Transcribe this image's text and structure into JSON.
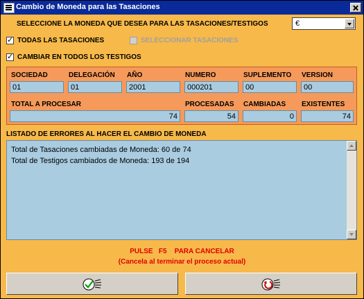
{
  "window": {
    "title": "Cambio de Moneda para las Tasaciones"
  },
  "currency": {
    "prompt": "SELECCIONE LA MONEDA QUE DESEA PARA LAS TASACIONES/TESTIGOS",
    "selected": "€"
  },
  "options": {
    "todas_tasaciones": {
      "label": "TODAS LAS TASACIONES",
      "checked": true
    },
    "seleccionar_tasaciones": {
      "label": "SELECCIONAR TASACIONES",
      "checked": false,
      "enabled": false
    },
    "cambiar_testigos": {
      "label": "CAMBIAR EN TODOS LOS TESTIGOS",
      "checked": true
    }
  },
  "fields": {
    "sociedad": {
      "label": "SOCIEDAD",
      "value": "01"
    },
    "delegacion": {
      "label": "DELEGACIÓN",
      "value": "01"
    },
    "anio": {
      "label": "AÑO",
      "value": "2001"
    },
    "numero": {
      "label": "NUMERO",
      "value": "000201"
    },
    "suplemento": {
      "label": "SUPLEMENTO",
      "value": "00"
    },
    "version": {
      "label": "VERSION",
      "value": "00"
    },
    "total": {
      "label": "TOTAL A PROCESAR",
      "value": "74"
    },
    "procesadas": {
      "label": "PROCESADAS",
      "value": "54"
    },
    "cambiadas": {
      "label": "CAMBIADAS",
      "value": "0"
    },
    "existentes": {
      "label": "EXISTENTES",
      "value": "74"
    }
  },
  "errors": {
    "title": "LISTADO DE ERRORES AL HACER EL CAMBIO DE MONEDA",
    "lines": [
      "Total de Tasaciones cambiadas de Moneda: 60 de 74",
      "Total de Testigos cambiados de Moneda: 193 de 194"
    ]
  },
  "cancel_hint": {
    "line1": "PULSE   F5    PARA CANCELAR",
    "line2": "(Cancela al terminar el proceso actual)"
  },
  "icons": {
    "accept": "check-icon",
    "cancel": "undo-icon"
  }
}
